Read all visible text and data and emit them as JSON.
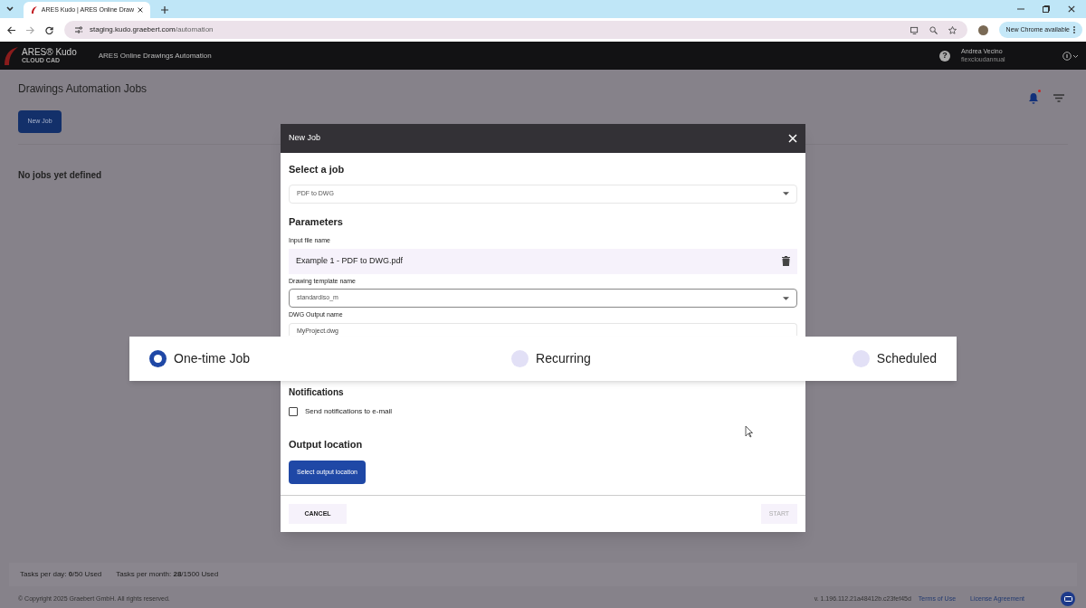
{
  "browser": {
    "tab_title": "ARES Kudo | ARES Online Draw",
    "url_host": "staging.kudo.graebert.com",
    "url_path": "/automation",
    "update_label": "New Chrome available"
  },
  "app_header": {
    "logo": "ARES® Kudo",
    "logo_sub": "CLOUD CAD",
    "title": "ARES Online Drawings Automation",
    "help_icon": "?",
    "user_name": "Andrea Vecino",
    "user_plan": "flexcloudannual"
  },
  "page": {
    "title": "Drawings Automation Jobs",
    "new_job_button": "New Job",
    "empty_message": "No jobs yet defined",
    "has_unread_notifications": true
  },
  "dialog": {
    "title": "New Job",
    "select_job_heading": "Select a job",
    "job_value": "PDF to DWG",
    "parameters_heading": "Parameters",
    "fields": [
      {
        "kind": "file",
        "label": "Input file name",
        "value": "Example 1 - PDF to DWG.pdf"
      },
      {
        "kind": "select",
        "label": "Drawing template name",
        "value": "standardiso_m"
      },
      {
        "kind": "text",
        "label": "DWG Output name",
        "value": "MyProject.dwg"
      }
    ],
    "notifications_heading": "Notifications",
    "notify_email": {
      "label": "Send notifications to e-mail",
      "checked": false
    },
    "output_heading": "Output location",
    "output_button": "Select output location",
    "cancel_button": "CANCEL",
    "start_button": {
      "label": "START",
      "disabled": true
    }
  },
  "schedule_options": [
    {
      "label": "One-time Job",
      "selected": true
    },
    {
      "label": "Recurring",
      "selected": false
    },
    {
      "label": "Scheduled",
      "selected": false
    }
  ],
  "footer": {
    "tasks_day": "Tasks per day: **0**/50 Used",
    "tasks_month": "Tasks per month: **28**/1500 Used",
    "copyright": "© Copyright 2025 Graebert GmbH. All rights reserved.",
    "version": "v. 1.196.112.21a48412b.c23fef45d",
    "terms": "Terms of Use",
    "license": "License Agreement"
  }
}
